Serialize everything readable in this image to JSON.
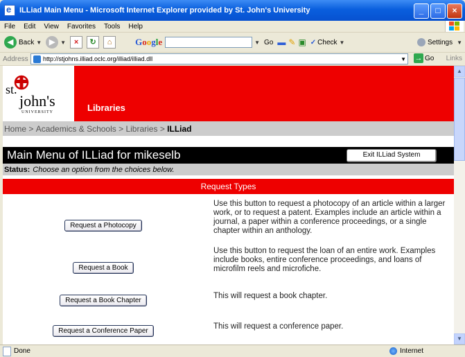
{
  "window": {
    "title": "ILLiad Main Menu - Microsoft Internet Explorer provided by St. John's University",
    "controls": [
      "_",
      "□",
      "×"
    ]
  },
  "menu": [
    "File",
    "Edit",
    "View",
    "Favorites",
    "Tools",
    "Help"
  ],
  "toolbar": {
    "back_label": "Back",
    "google_label": "Google",
    "go_label": "Go",
    "check_label": "Check",
    "settings_label": "Settings"
  },
  "address": {
    "label": "Address",
    "url": "http://stjohns.illiad.oclc.org/illiad/illiad.dll",
    "go_label": "Go",
    "links_label": "Links"
  },
  "page": {
    "logo": {
      "line1": "st.",
      "line2": "john's",
      "line3": "UNIVERSITY"
    },
    "libraries_label": "Libraries",
    "breadcrumb": {
      "items": [
        "Home",
        "Academics & Schools",
        "Libraries"
      ],
      "separator": " > ",
      "current": "ILLiad"
    },
    "main_title": "Main Menu of ILLiad for mikeselb",
    "exit_label": "Exit ILLiad System",
    "status_label": "Status:",
    "status_text": "Choose an option from the choices below.",
    "section_header": "Request Types",
    "requests": [
      {
        "button": "Request a Photocopy",
        "description": "Use this button to request a photocopy of an article within a larger work, or to request a patent. Examples include an article within a journal, a paper  within a conference proceedings, or a single chapter within an anthology."
      },
      {
        "button": "Request a Book",
        "description": "Use this button to request the loan of an entire work. Examples include books, entire conference proceedings, and loans of microfilm reels and microfiche."
      },
      {
        "button": "Request a Book Chapter",
        "description": "This will request a book chapter."
      },
      {
        "button": "Request a Conference Paper",
        "description": "This will request a conference paper."
      }
    ]
  },
  "statusbar": {
    "left": "Done",
    "zone": "Internet"
  },
  "colors": {
    "red": "#ee0000",
    "gray": "#cccccc",
    "xp_blue": "#0a5fde"
  }
}
